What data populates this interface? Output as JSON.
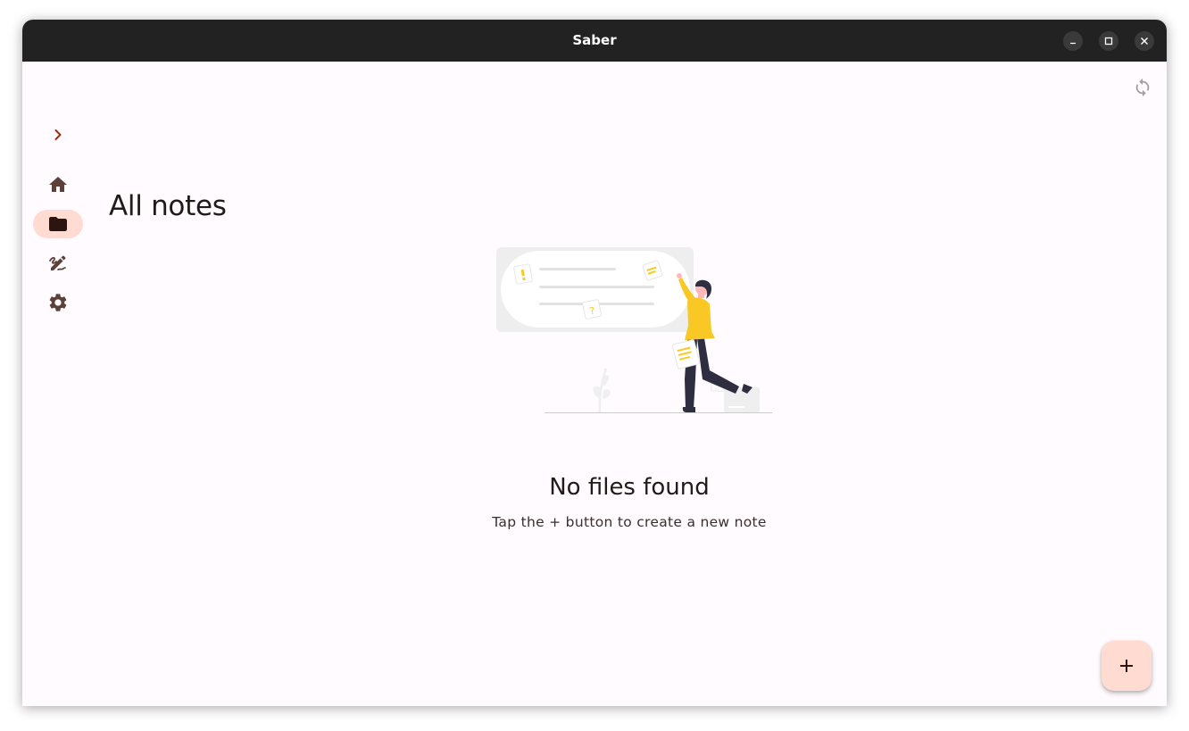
{
  "window": {
    "title": "Saber"
  },
  "nav_rail": {
    "expand_icon": "chevron-right-icon",
    "items": [
      {
        "icon": "home-icon",
        "active": false
      },
      {
        "icon": "folder-icon",
        "active": true
      },
      {
        "icon": "edit-note-icon",
        "active": false
      },
      {
        "icon": "settings-icon",
        "active": false
      }
    ]
  },
  "main": {
    "page_title": "All notes",
    "sync_icon": "sync-icon",
    "empty_state": {
      "title": "No files found",
      "subtitle": "Tap the + button to create a new note"
    },
    "fab_icon": "plus-icon"
  },
  "colors": {
    "accent": "#9c2d0f",
    "rail_active_bg": "#ffdbd1",
    "fab_bg": "#ffdbd1",
    "titlebar_bg": "#222222",
    "background": "#fffbff",
    "illustration_yellow": "#f9c824"
  }
}
